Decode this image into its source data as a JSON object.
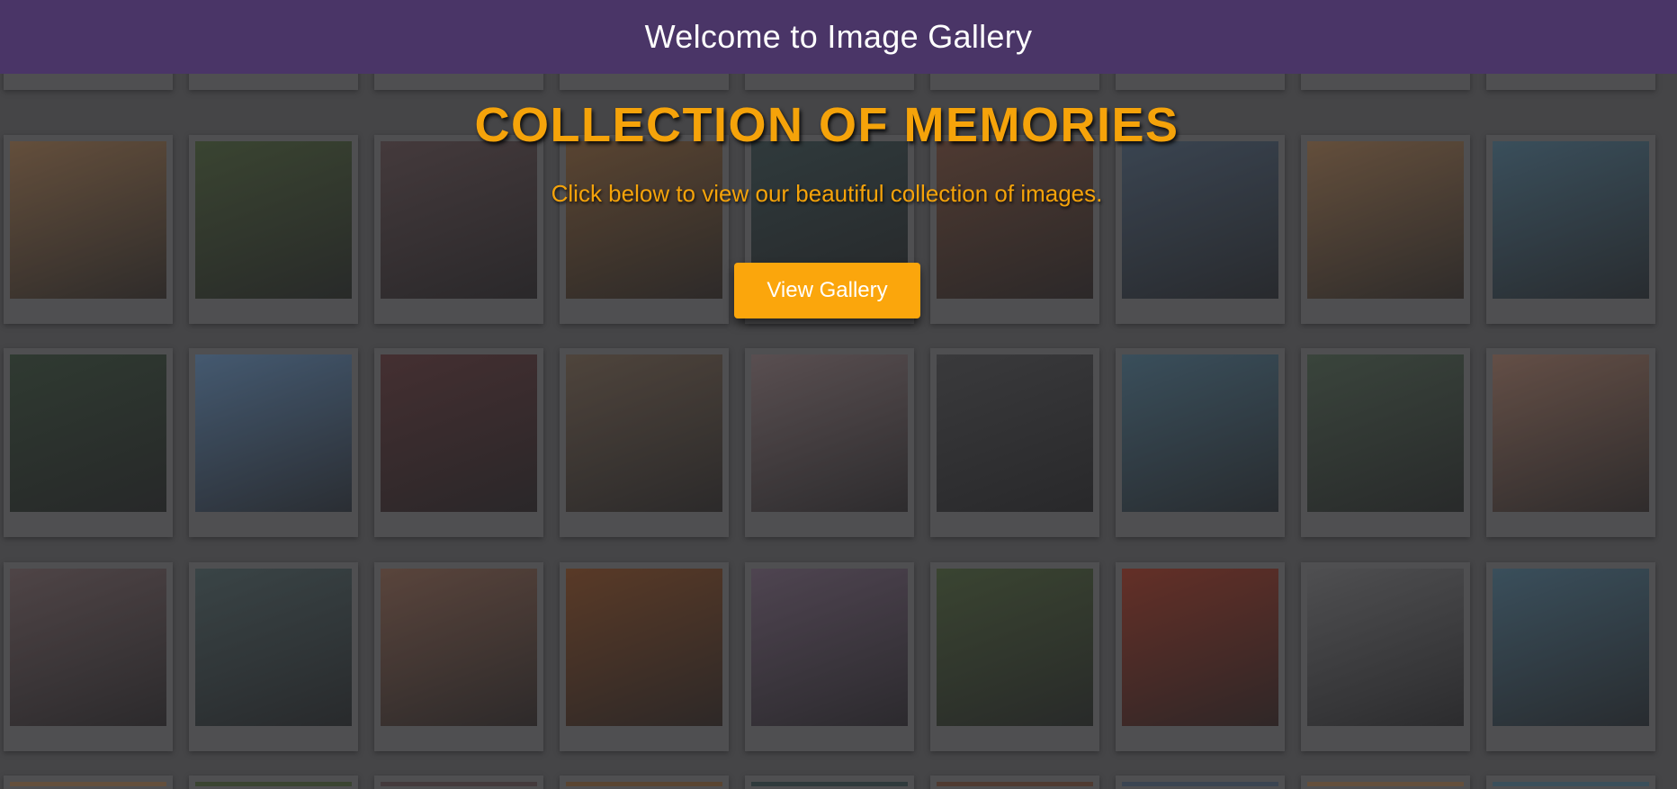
{
  "header": {
    "title": "Welcome to Image Gallery",
    "background": "#4a3567"
  },
  "hero": {
    "title": "COLLECTION OF MEMORIES",
    "subtitle": "Click below to view our beautiful collection of images.",
    "button_label": "View Gallery",
    "accent": "#f5a30a"
  },
  "background_wall": {
    "description_icon": "photo-wall",
    "photo_tones": [
      [
        "#8a6a4a",
        "#4a5a3a",
        "#5a4a4a",
        "#7a5a3a",
        "#3a4a4a",
        "#6a4a3a",
        "#4a5a6a",
        "#8a6a4a",
        "#4a6a7a"
      ],
      [
        "#3a4a3a",
        "#5a7a9a",
        "#5a3a3a",
        "#6a5a4a",
        "#7a6a6a",
        "#4a4a4a",
        "#4a6a7a",
        "#4a5a4a",
        "#8a6a5a"
      ],
      [
        "#6a5a5a",
        "#4a5a5a",
        "#7a5a4a",
        "#7a4a2a",
        "#6a5a6a",
        "#4a5a3a",
        "#8a3a2a",
        "#6a6a6a",
        "#4a6a7a"
      ]
    ]
  }
}
